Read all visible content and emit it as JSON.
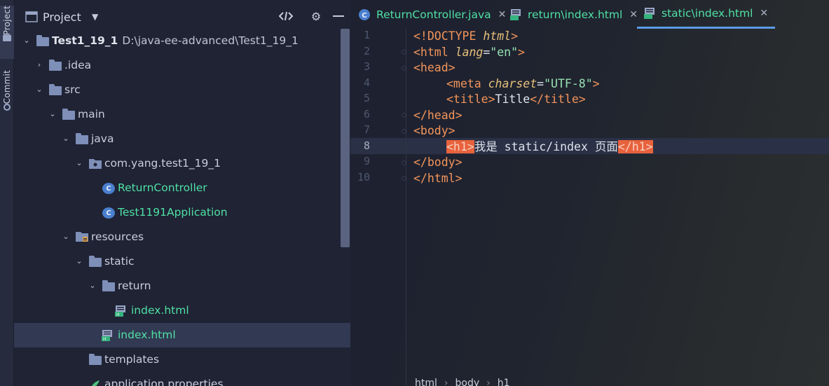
{
  "tool_stripe": {
    "project_label": "Project",
    "commit_label": "Commit"
  },
  "project_panel": {
    "title": "Project",
    "tree": [
      {
        "label": "Test1_19_1",
        "path": "D:\\java-ee-advanced\\Test1_19_1",
        "type": "module",
        "expanded": true
      },
      {
        "label": ".idea",
        "type": "folder",
        "expanded": false
      },
      {
        "label": "src",
        "type": "folder",
        "expanded": true
      },
      {
        "label": "main",
        "type": "folder",
        "expanded": true
      },
      {
        "label": "java",
        "type": "folder",
        "expanded": true
      },
      {
        "label": "com.yang.test1_19_1",
        "type": "package",
        "expanded": true
      },
      {
        "label": "ReturnController",
        "type": "class"
      },
      {
        "label": "Test1191Application",
        "type": "class"
      },
      {
        "label": "resources",
        "type": "folder",
        "expanded": true
      },
      {
        "label": "static",
        "type": "folder",
        "expanded": true
      },
      {
        "label": "return",
        "type": "folder",
        "expanded": true
      },
      {
        "label": "index.html",
        "type": "html"
      },
      {
        "label": "index.html",
        "type": "html",
        "selected": true
      },
      {
        "label": "templates",
        "type": "folder"
      },
      {
        "label": "application.properties",
        "type": "properties"
      }
    ]
  },
  "tabs": [
    {
      "label": "ReturnController.java",
      "icon": "class-icon",
      "active": false
    },
    {
      "label": "return\\index.html",
      "icon": "html-file-icon",
      "active": false
    },
    {
      "label": "static\\index.html",
      "icon": "html-file-icon",
      "active": true
    }
  ],
  "editor": {
    "line_numbers": [
      "1",
      "2",
      "3",
      "4",
      "5",
      "6",
      "7",
      "8",
      "9",
      "10"
    ],
    "current_line": "8",
    "code": {
      "l1_doctype": "<!DOCTYPE",
      "l1_html": "html",
      "l1_close": ">",
      "l2_open": "<html",
      "l2_attr": "lang",
      "l2_eq": "=",
      "l2_val": "\"en\"",
      "l2_close": ">",
      "l3": "<head>",
      "l4_open": "<meta",
      "l4_attr": "charset",
      "l4_eq": "=",
      "l4_val": "\"UTF-8\"",
      "l4_close": ">",
      "l5_open": "<title>",
      "l5_text": "Title",
      "l5_close": "</title>",
      "l6": "</head>",
      "l7": "<body>",
      "l8_open": "<h1>",
      "l8_text": "我是 static/index 页面",
      "l8_close": "</h1>",
      "l9": "</body>",
      "l10": "</html>"
    }
  },
  "breadcrumb": [
    "html",
    "body",
    "h1"
  ],
  "colors": {
    "accent_tab": "#5b9be6",
    "file_green": "#4fe0a4",
    "tag_highlight": "#e8623c"
  }
}
